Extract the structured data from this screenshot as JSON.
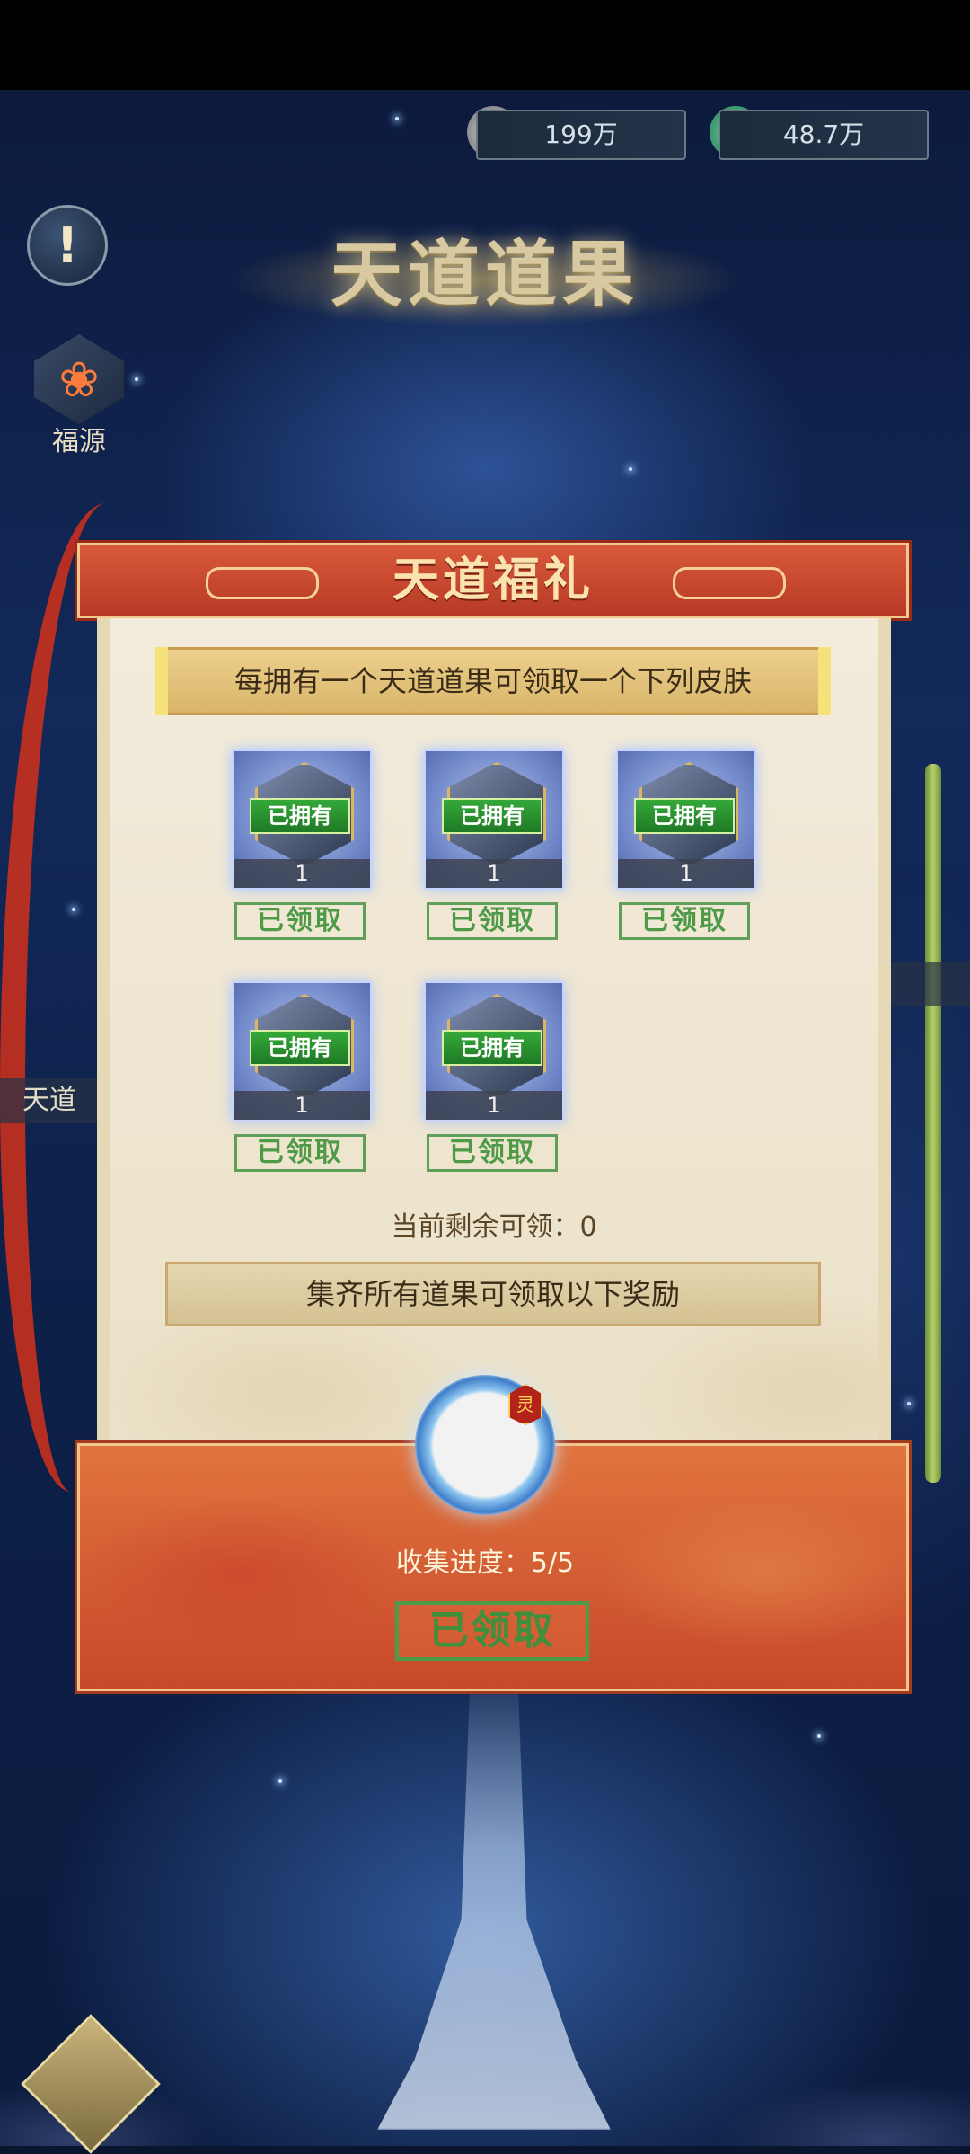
{
  "currency": [
    {
      "icon": "taiji-icon",
      "value": "199万"
    },
    {
      "icon": "jade-dragon-icon",
      "value": "48.7万"
    }
  ],
  "left_menu": {
    "help_symbol": "!",
    "fuyuan_label": "福源",
    "side_label_left": "天道"
  },
  "page_title": "天道道果",
  "panel": {
    "title": "天道福礼",
    "banner": "每拥有一个天道道果可领取一个下列皮肤",
    "items": [
      {
        "owned_label": "已拥有",
        "count": "1",
        "claim_label": "已领取"
      },
      {
        "owned_label": "已拥有",
        "count": "1",
        "claim_label": "已领取"
      },
      {
        "owned_label": "已拥有",
        "count": "1",
        "claim_label": "已领取"
      },
      {
        "owned_label": "已拥有",
        "count": "1",
        "claim_label": "已领取"
      },
      {
        "owned_label": "已拥有",
        "count": "1",
        "claim_label": "已领取"
      }
    ],
    "remaining": "当前剩余可领：0",
    "banner2": "集齐所有道果可领取以下奖励",
    "reward_badge": "灵",
    "progress": "收集进度：5/5",
    "final_claim_label": "已领取"
  },
  "colors": {
    "panel_red": "#c8492a",
    "parchment": "#f3ecdc",
    "owned_green": "#2f9a35",
    "claim_green": "#4e9a46"
  }
}
